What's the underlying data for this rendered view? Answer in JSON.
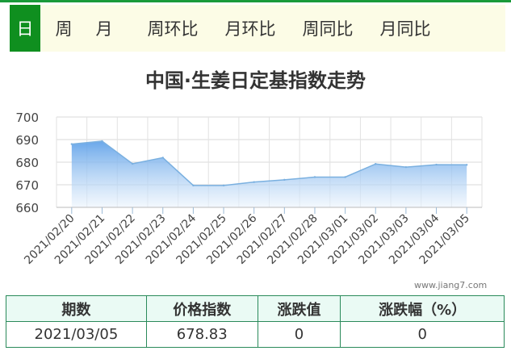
{
  "tabs": [
    {
      "label": "日",
      "active": true
    },
    {
      "label": "周",
      "active": false
    },
    {
      "label": "月",
      "active": false
    },
    {
      "label": "周环比",
      "active": false
    },
    {
      "label": "月环比",
      "active": false
    },
    {
      "label": "周同比",
      "active": false
    },
    {
      "label": "月同比",
      "active": false
    }
  ],
  "watermark": "www.jiang7.com",
  "colors": {
    "accent": "#0f8f1f",
    "tabbar_bg": "#fcfce6",
    "series_line": "#7ab0e0",
    "series_fill_top": "#5a9ee8",
    "series_fill_bottom": "#eaf3fc",
    "table_border": "#2a8a5a",
    "table_header_bg": "#eafaf4"
  },
  "chart_data": {
    "type": "area",
    "title": "中国·生姜日定基指数走势",
    "xlabel": "",
    "ylabel": "",
    "categories": [
      "2021/02/20",
      "2021/02/21",
      "2021/02/22",
      "2021/02/23",
      "2021/02/24",
      "2021/02/25",
      "2021/02/26",
      "2021/02/27",
      "2021/02/28",
      "2021/03/01",
      "2021/03/02",
      "2021/03/03",
      "2021/03/04",
      "2021/03/05"
    ],
    "series": [
      {
        "values": [
          688.0,
          689.3,
          679.3,
          682.0,
          669.7,
          669.7,
          671.2,
          672.2,
          673.4,
          673.4,
          679.2,
          677.8,
          678.9,
          678.83
        ]
      }
    ],
    "yticks": [
      660,
      670,
      680,
      690,
      700
    ],
    "ylim": [
      660,
      700
    ],
    "grid": true
  },
  "table": {
    "headers": [
      "期数",
      "价格指数",
      "涨跌值",
      "涨跌幅（%）"
    ],
    "row": [
      "2021/03/05",
      "678.83",
      "0",
      "0"
    ]
  }
}
